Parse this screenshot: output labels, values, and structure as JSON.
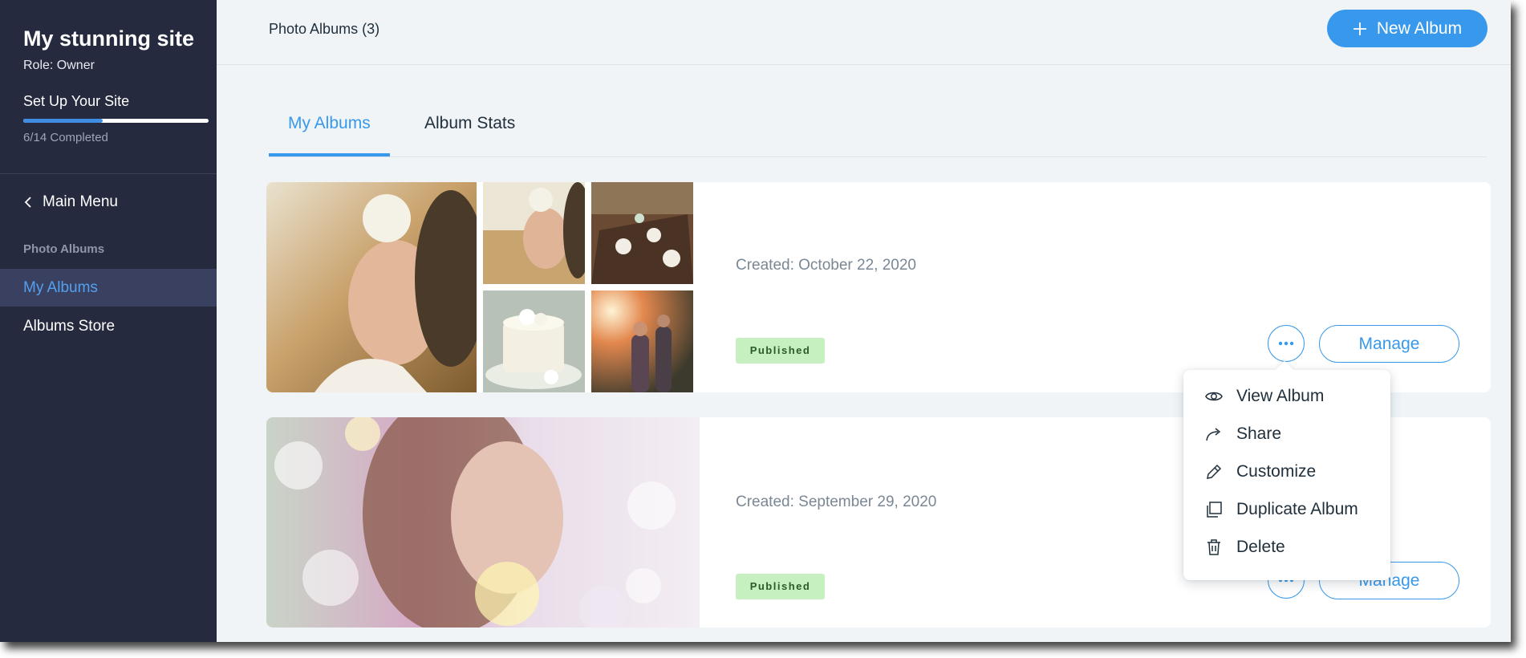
{
  "sidebar": {
    "site_name": "My stunning site",
    "role": "Role: Owner",
    "setup_title": "Set Up Your Site",
    "progress_completed": 6,
    "progress_total": 14,
    "progress_text": "6/14 Completed",
    "back_label": "Main Menu",
    "section_label": "Photo Albums",
    "items": [
      {
        "label": "My Albums",
        "active": true
      },
      {
        "label": "Albums Store",
        "active": false
      }
    ]
  },
  "header": {
    "title": "Photo Albums (3)",
    "new_album_label": "New Album"
  },
  "tabs": [
    {
      "label": "My Albums",
      "active": true
    },
    {
      "label": "Album Stats",
      "active": false
    }
  ],
  "albums": [
    {
      "created": "Created: October 22, 2020",
      "status": "Published",
      "manage_label": "Manage"
    },
    {
      "created": "Created: September 29, 2020",
      "status": "Published",
      "manage_label": "Manage"
    }
  ],
  "dropdown": {
    "items": [
      {
        "label": "View Album",
        "icon": "eye-icon"
      },
      {
        "label": "Share",
        "icon": "share-arrow-icon"
      },
      {
        "label": "Customize",
        "icon": "pencil-icon"
      },
      {
        "label": "Duplicate Album",
        "icon": "duplicate-icon"
      },
      {
        "label": "Delete",
        "icon": "trash-icon"
      }
    ]
  },
  "colors": {
    "sidebar_bg": "#252a3e",
    "accent": "#3899ec",
    "active_nav_bg": "#3a4060",
    "badge_bg": "#c7f0c0",
    "page_bg": "#f0f4f7"
  }
}
